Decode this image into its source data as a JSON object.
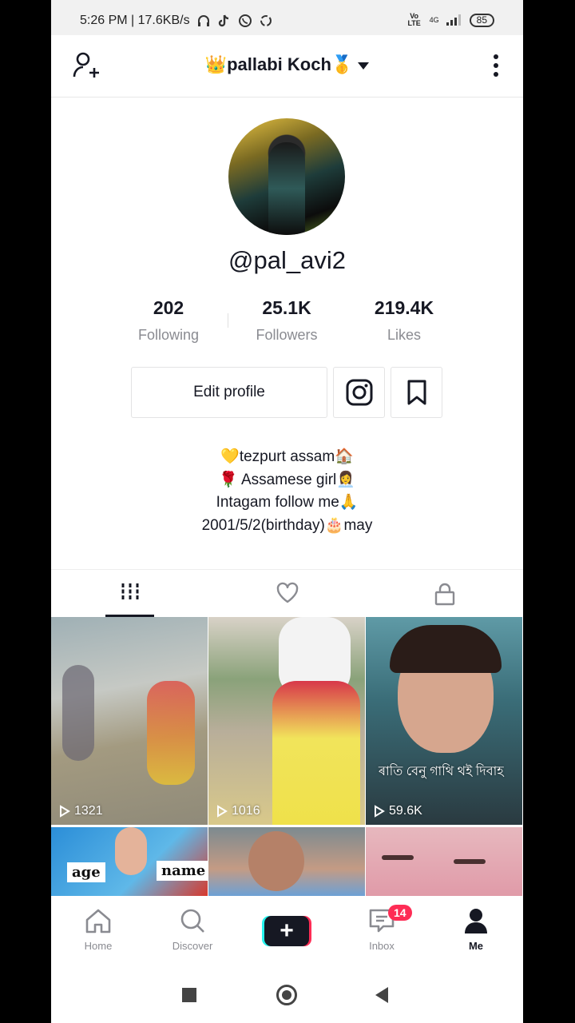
{
  "status_bar": {
    "time_speed": "5:26 PM | 17.6KB/s",
    "network": "Vo LTE",
    "signal": "4G",
    "battery": "85"
  },
  "header": {
    "title": "👑pallabi Koch🥇"
  },
  "profile": {
    "handle": "@pal_avi2",
    "stats": [
      {
        "value": "202",
        "label": "Following"
      },
      {
        "value": "25.1K",
        "label": "Followers"
      },
      {
        "value": "219.4K",
        "label": "Likes"
      }
    ],
    "edit_label": "Edit profile",
    "bio": [
      "💛tezpurt assam🏠",
      "🌹 Assamese girl👩‍💼",
      "Intagam follow me🙏",
      "2001/5/2(birthday)🎂may"
    ]
  },
  "tabs": [
    "videos-tab",
    "liked-tab",
    "private-tab"
  ],
  "videos": [
    {
      "views": "1321"
    },
    {
      "views": "1016"
    },
    {
      "views": "59.6K",
      "caption": "ৰাতি বেনু গাথি থই দিবাহ"
    },
    {
      "tag_left": "age",
      "tag_right": "name"
    },
    {},
    {}
  ],
  "nav": {
    "home": "Home",
    "discover": "Discover",
    "inbox": "Inbox",
    "inbox_badge": "14",
    "me": "Me"
  },
  "colors": {
    "text": "#161823",
    "muted": "#8a8b91",
    "accent_red": "#fe2c55",
    "accent_cyan": "#25f4ee"
  }
}
